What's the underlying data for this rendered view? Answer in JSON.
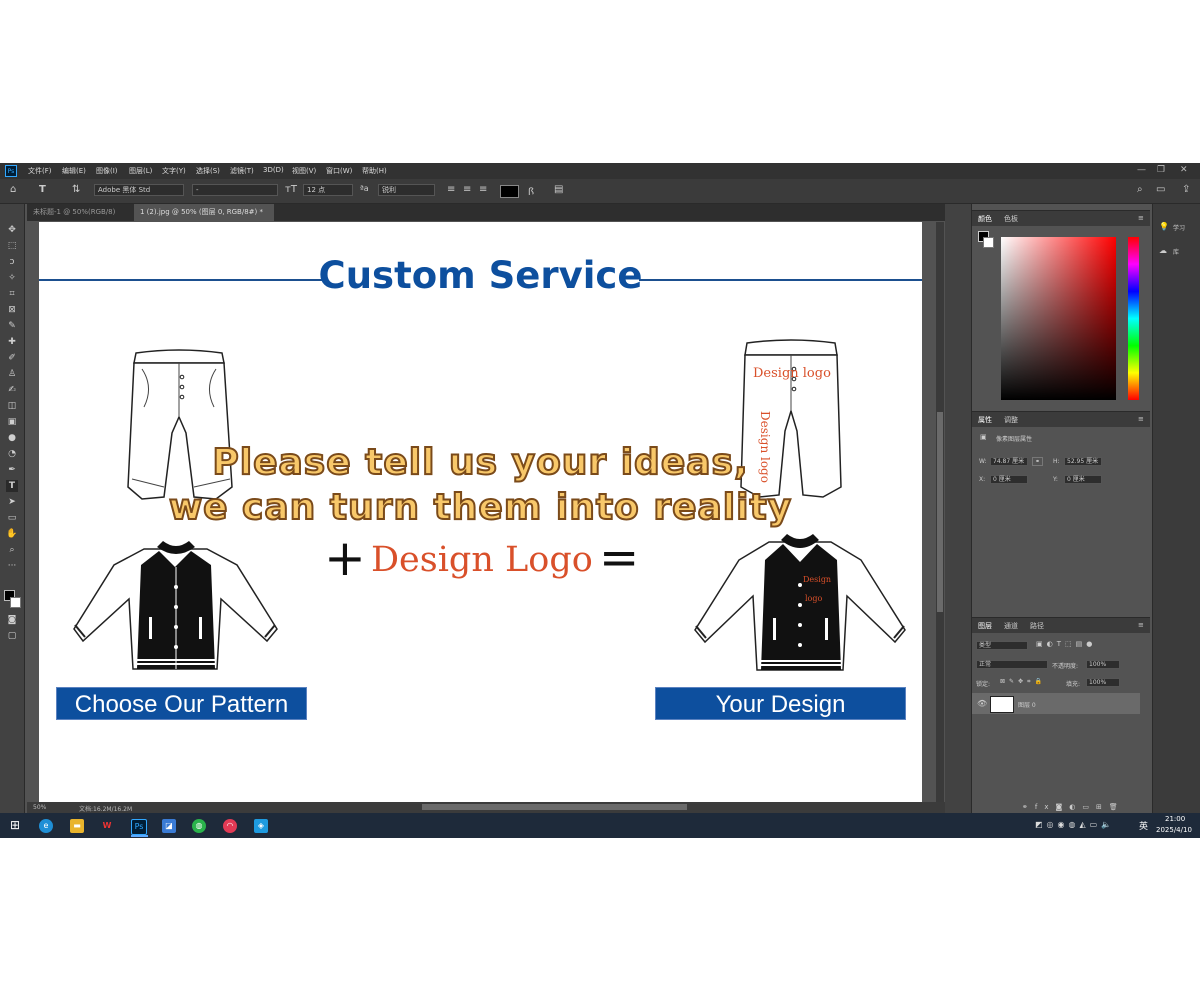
{
  "menubar": {
    "logo": "Ps",
    "items": [
      "文件(F)",
      "编辑(E)",
      "图像(I)",
      "图层(L)",
      "文字(Y)",
      "选择(S)",
      "滤镜(T)",
      "3D(D)",
      "视图(V)",
      "窗口(W)",
      "帮助(H)"
    ]
  },
  "options": {
    "font_family": "Adobe 黑体 Std",
    "font_style": "-",
    "font_size": "12 点",
    "anti_alias": "锐利"
  },
  "tabs": [
    {
      "label": "未标题-1 @ 50%(RGB/8)",
      "active": false
    },
    {
      "label": "1 (2).jpg @ 50% (图层 0, RGB/8#) *",
      "active": true
    }
  ],
  "canvas": {
    "title": "Custom Service",
    "ideas_line1": "Please tell us your ideas,",
    "ideas_line2": "we can turn them into reality",
    "plus": "+",
    "design_logo": "Design Logo",
    "equals": "=",
    "logo_small": "Design logo",
    "logo_vertical": "Design logo",
    "logo_jacket_1": "Design",
    "logo_jacket_2": "logo",
    "left_button": "Choose Our Pattern",
    "right_button": "Your  Design"
  },
  "status": {
    "zoom": "50%",
    "doc": "文档:16.2M/16.2M"
  },
  "panels": {
    "color_tabs": [
      "颜色",
      "色板"
    ],
    "props_tabs": [
      "属性",
      "调整"
    ],
    "props_title": "像素图层属性",
    "w_label": "W:",
    "w_value": "74.87 厘米",
    "h_label": "H:",
    "h_value": "52.95 厘米",
    "x_label": "X:",
    "x_value": "0 厘米",
    "y_label": "Y:",
    "y_value": "0 厘米",
    "layers_tabs": [
      "图层",
      "通道",
      "路径"
    ],
    "kind": "类型",
    "blend": "正常",
    "opacity_label": "不透明度:",
    "opacity": "100%",
    "lock_label": "锁定:",
    "fill_label": "填充:",
    "fill": "100%",
    "layer_name": "图层 0"
  },
  "farright": {
    "learn": "学习",
    "libraries": "库"
  },
  "taskbar": {
    "ime": "英",
    "time": "21:00",
    "date": "2025/4/10"
  }
}
